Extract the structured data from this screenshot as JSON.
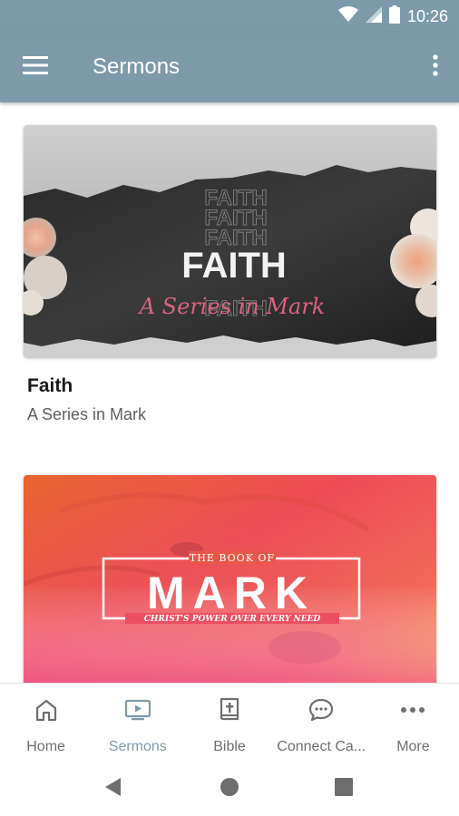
{
  "status_bar": {
    "time": "10:26",
    "icons": [
      "wifi-icon",
      "signal-icon",
      "battery-icon"
    ]
  },
  "app_bar": {
    "title": "Sermons",
    "menu_icon": "menu-icon",
    "overflow_icon": "overflow-icon"
  },
  "sermons": [
    {
      "title": "Faith",
      "subtitle": "A Series in Mark",
      "artwork": {
        "repeat_word": "FAITH",
        "headline": "FAITH",
        "script": "A Series in Mark"
      }
    },
    {
      "artwork": {
        "kicker": "THE BOOK OF",
        "headline": "MARK",
        "tagline": "CHRIST'S POWER OVER EVERY NEED"
      }
    }
  ],
  "bottom_nav": {
    "items": [
      {
        "label": "Home",
        "icon": "home-icon",
        "active": false
      },
      {
        "label": "Sermons",
        "icon": "tv-play-icon",
        "active": true
      },
      {
        "label": "Bible",
        "icon": "bible-icon",
        "active": false
      },
      {
        "label": "Connect Ca...",
        "icon": "chat-bubble-icon",
        "active": false
      },
      {
        "label": "More",
        "icon": "more-icon",
        "active": false
      }
    ]
  },
  "system_nav": {
    "back_icon": "back-icon",
    "home_icon": "home-circle-icon",
    "recents_icon": "recents-icon"
  },
  "colors": {
    "primary": "#7d9aab",
    "title_text": "#1a1a1a",
    "subtitle_text": "#5f5f5f",
    "accent_pink": "#d9637e"
  }
}
